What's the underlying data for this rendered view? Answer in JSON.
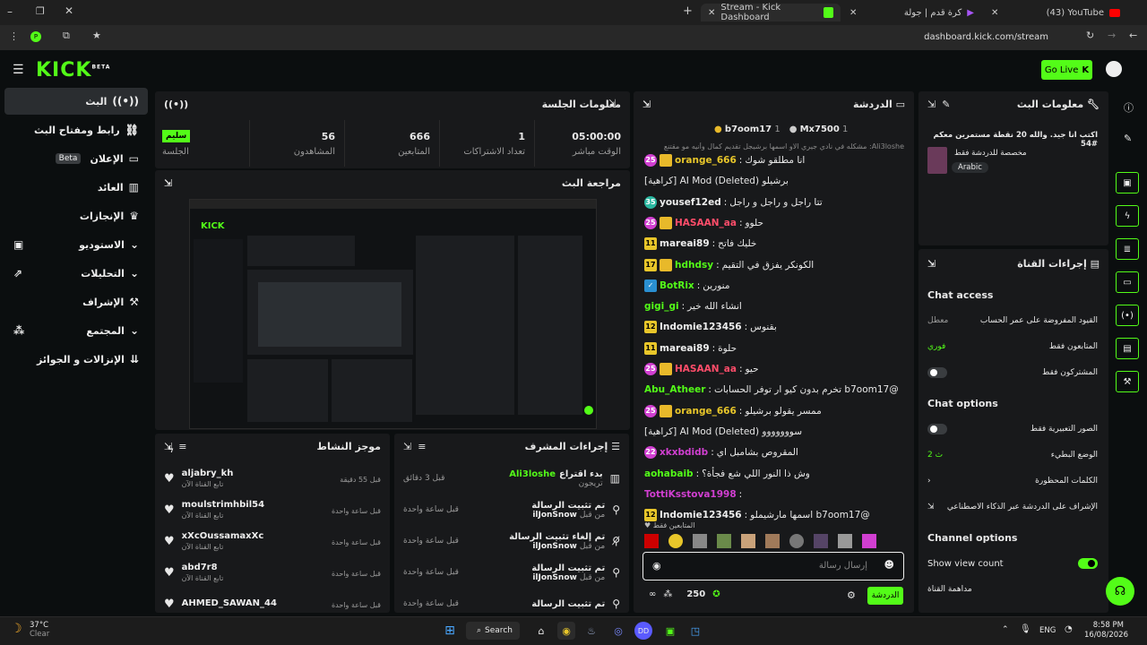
{
  "browser": {
    "tabs": [
      {
        "title": "Stream - Kick Dashboard",
        "active": true
      },
      {
        "title": "كرة قدم | جولة",
        "active": false
      },
      {
        "title": "(43) YouTube",
        "active": false
      }
    ],
    "url": "dashboard.kick.com/stream"
  },
  "header": {
    "logo": "KICK",
    "logo_sup": "BETA",
    "go_live": "Go Live"
  },
  "sidebar": {
    "items": [
      {
        "label": "البث",
        "icon": "broadcast-icon",
        "active": true
      },
      {
        "label": "رابط ومفتاح البث",
        "icon": "link-icon"
      },
      {
        "label": "الإعلان",
        "badge": "Beta",
        "icon": "ad-icon"
      },
      {
        "label": "العائد",
        "icon": "chart-icon"
      },
      {
        "label": "الإنجازات",
        "icon": "trophy-icon"
      },
      {
        "label": "الاستوديو",
        "icon": "studio-icon"
      },
      {
        "label": "التحليلات",
        "icon": "analytics-icon"
      },
      {
        "label": "الإشراف",
        "icon": "wrench-icon"
      },
      {
        "label": "المجتمع",
        "icon": "community-icon"
      },
      {
        "label": "الإنزالات و الجوائز",
        "icon": "drops-icon"
      }
    ]
  },
  "session": {
    "title": "معلومات الجلسة",
    "stats": [
      {
        "value": "05:00:00",
        "label": "الوقت مباشر"
      },
      {
        "value": "1",
        "label": "تعداد الاشتراكات"
      },
      {
        "value": "666",
        "label": "المتابعين"
      },
      {
        "value": "56",
        "label": "المشاهدون"
      },
      {
        "value": "سليم",
        "label": "الجلسة"
      }
    ]
  },
  "preview": {
    "title": "مراجعة البث"
  },
  "activity": {
    "title": "موجز النشاط",
    "rows": [
      {
        "name": "aljabry_kh",
        "sub": "تابع القناة الآن",
        "time": "قبل 55 دقيقة"
      },
      {
        "name": "moulstrimhbil54",
        "sub": "تابع القناة الآن",
        "time": "قبل ساعة واحدة"
      },
      {
        "name": "xXcOussamaxXc",
        "sub": "تابع القناة الآن",
        "time": "قبل ساعة واحدة"
      },
      {
        "name": "abd7r8",
        "sub": "تابع القناة الآن",
        "time": "قبل ساعة واحدة"
      },
      {
        "name": "AHMED_SAWAN_44",
        "sub": "",
        "time": "قبل ساعة واحدة"
      }
    ]
  },
  "modactions": {
    "title": "إجراءات المشرف",
    "rows": [
      {
        "title": "بدء اقتراع",
        "actor": "Ali3loshe",
        "sub": "تريجون",
        "time": "قبل 3 دقائق"
      },
      {
        "title": "تم تثبيت الرسالة",
        "actor": "ilJonSnow",
        "sub": "من قبل",
        "time": "قبل ساعة واحدة"
      },
      {
        "title": "تم إلغاء تثبيت الرسالة",
        "actor": "ilJonSnow",
        "sub": "من قبل",
        "time": "قبل ساعة واحدة"
      },
      {
        "title": "تم تثبيت الرسالة",
        "actor": "ilJonSnow",
        "sub": "من قبل",
        "time": "قبل ساعة واحدة"
      },
      {
        "title": "تم تثبيت الرسالة",
        "actor": "",
        "sub": "",
        "time": "قبل ساعة واحدة"
      }
    ]
  },
  "chat": {
    "title": "الدردشة",
    "top": [
      {
        "name": "b7oom17",
        "count": "1"
      },
      {
        "name": "Mx7500",
        "count": "1"
      }
    ],
    "pinned_text": "Ali3loshe: مشكله في نادي جيري الاو اسمها برشيجل تقديم كمال وأنيه مو مقتنع",
    "messages": [
      {
        "badge": "25",
        "bcolor": "#d13fd1",
        "crown": true,
        "user": "orange_666",
        "ucolor": "#e8c62a",
        "text": "انا مطلقو شوك"
      },
      {
        "badge": "",
        "bcolor": "",
        "crown": false,
        "user": "",
        "ucolor": "#eee",
        "text": "برشيلو (Deleted) AI Mod [كراهية]"
      },
      {
        "badge": "35",
        "bcolor": "#2ab7a0",
        "crown": false,
        "user": "yousef12ed",
        "ucolor": "#eee",
        "text": "تتا راجل و راجل و راجل"
      },
      {
        "badge": "25",
        "bcolor": "#d13fd1",
        "crown": true,
        "user": "HASAAN_aa",
        "ucolor": "#ff4d6a",
        "text": "حلوو"
      },
      {
        "badge": "11",
        "bcolor": "#e8c62a",
        "crown": false,
        "user": "mareai89",
        "ucolor": "#eee",
        "text": "خليك فاتح"
      },
      {
        "badge": "17",
        "bcolor": "#e8c62a",
        "crown": true,
        "user": "hdhdsy",
        "ucolor": "#53fc18",
        "text": "الكونكر يفزق في التقيم"
      },
      {
        "badge": "",
        "bcolor": "#2a8fd1",
        "crown": false,
        "user": "BotRix",
        "ucolor": "#53fc18",
        "text": "منورين"
      },
      {
        "badge": "",
        "bcolor": "",
        "crown": false,
        "user": "gigi_gi",
        "ucolor": "#53fc18",
        "text": "انشاء الله خير"
      },
      {
        "badge": "12",
        "bcolor": "#e8c62a",
        "crown": false,
        "user": "Indomie123456",
        "ucolor": "#eee",
        "text": "بقنوس"
      },
      {
        "badge": "11",
        "bcolor": "#e8c62a",
        "crown": false,
        "user": "mareai89",
        "ucolor": "#eee",
        "text": "حلوة"
      },
      {
        "badge": "25",
        "bcolor": "#d13fd1",
        "crown": true,
        "user": "HASAAN_aa",
        "ucolor": "#ff4d6a",
        "text": "حيو"
      },
      {
        "badge": "",
        "bcolor": "",
        "crown": false,
        "user": "Abu_Atheer",
        "ucolor": "#53fc18",
        "text": "@b7oom17 تخرم بدون كيو ار توفر الحسابات"
      },
      {
        "badge": "25",
        "bcolor": "#d13fd1",
        "crown": true,
        "user": "orange_666",
        "ucolor": "#e8c62a",
        "text": "ممسر يقولو برشيلو"
      },
      {
        "badge": "",
        "bcolor": "",
        "crown": false,
        "user": "",
        "ucolor": "#eee",
        "text": "سووووووو (Deleted) AI Mod [كراهية]"
      },
      {
        "badge": "22",
        "bcolor": "#d13fd1",
        "crown": false,
        "user": "xkxbdidb",
        "ucolor": "#d13fd1",
        "text": "المقروص بشامبل اي"
      },
      {
        "badge": "",
        "bcolor": "",
        "crown": false,
        "user": "aohabaib",
        "ucolor": "#53fc18",
        "text": "وش ذا النور اللي شع فجأة؟"
      },
      {
        "badge": "",
        "bcolor": "",
        "crown": false,
        "user": "TottiKsstova1998",
        "ucolor": "#d13fd1",
        "text": ""
      },
      {
        "badge": "12",
        "bcolor": "#e8c62a",
        "crown": false,
        "user": "Indomie123456",
        "ucolor": "#eee",
        "text": "@b7oom17 اسمها مارشيملو"
      }
    ],
    "followers_only": "المتابعين فقط",
    "input_placeholder": "إرسال رسالة",
    "viewer_count": "250",
    "send_label": "الدردشة"
  },
  "streaminfo": {
    "title": "معلومات البث",
    "stream_title": "اكتب انا جيد. والله 20 نقطة مستمرين معكم #54",
    "category": "مخصصة للدردشة فقط",
    "language": "Arabic"
  },
  "channelactions": {
    "title": "إجراءات القناة",
    "chat_access": "Chat access",
    "access_rows": [
      {
        "label": "القيود المفروضة على عمر الحساب",
        "value": "معطل"
      },
      {
        "label": "المتابعون فقط",
        "value": "فوري"
      },
      {
        "label": "المشتركون فقط",
        "value": ""
      }
    ],
    "chat_options": "Chat options",
    "option_rows": [
      {
        "label": "الصور التعبيرية فقط",
        "value": ""
      },
      {
        "label": "الوضع البطيء",
        "value": "2 ث"
      },
      {
        "label": "الكلمات المحظورة",
        "value": ""
      },
      {
        "label": "الإشراف على الدردشة عبر الذكاء الاصطناعي",
        "value": ""
      }
    ],
    "channel_options": "Channel options",
    "show_view_count": "Show view count",
    "share": "مداهمة القناة"
  },
  "taskbar": {
    "temp": "37°C",
    "weather": "Clear",
    "search": "Search",
    "lang": "ENG",
    "time": "8:58 PM",
    "date": "16/08/2026"
  },
  "colors": {
    "accent": "#53fc18",
    "panel": "#18191b",
    "bg": "#0b0e0f"
  }
}
